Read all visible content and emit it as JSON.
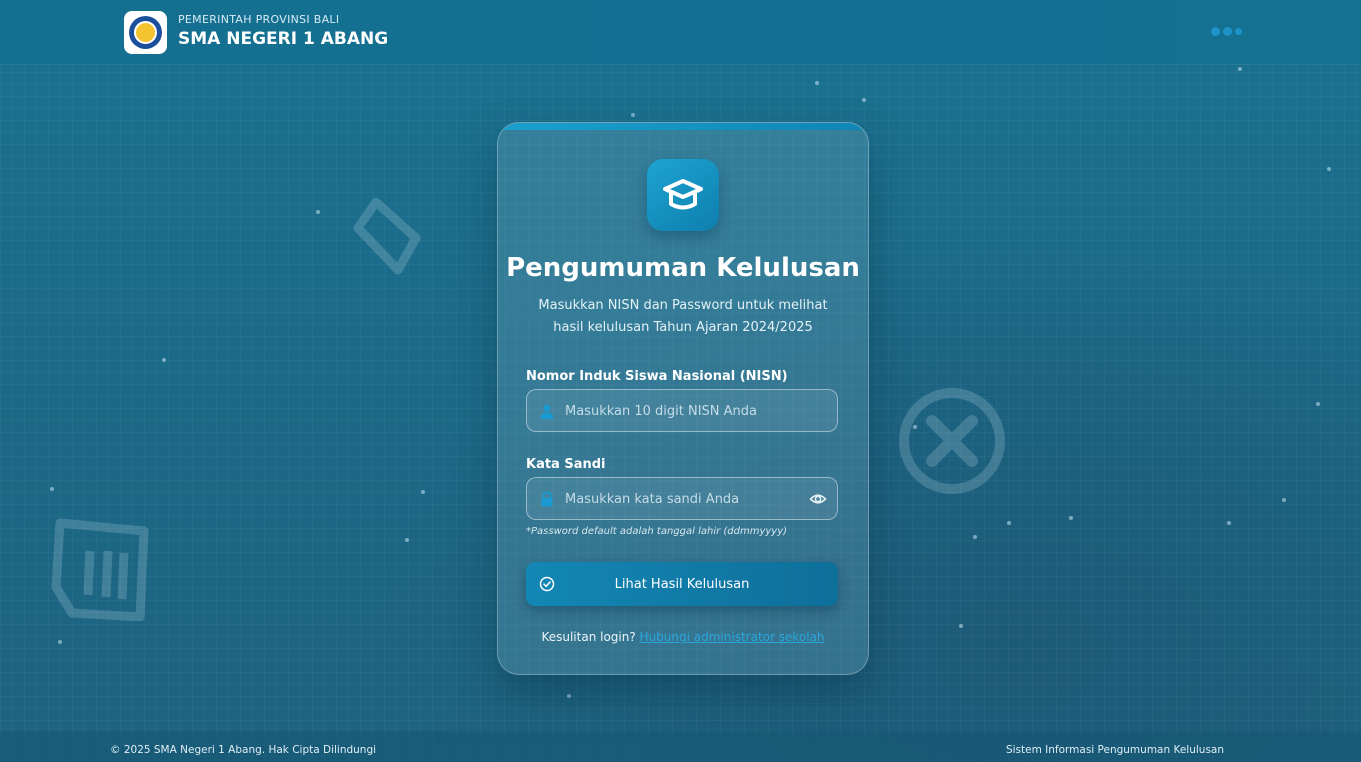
{
  "header": {
    "government": "PEMERINTAH PROVINSI BALI",
    "school_name": "SMA NEGERI 1 ABANG",
    "logo_icon": "school-crest-icon",
    "menu_icon": "more-dots-icon"
  },
  "card": {
    "app_icon": "graduation-cap-icon",
    "title": "Pengumuman Kelulusan",
    "subtitle_line1": "Masukkan NISN dan Password untuk melihat",
    "subtitle_line2": "hasil kelulusan Tahun Ajaran 2024/2025",
    "nisn": {
      "label": "Nomor Induk Siswa Nasional (NISN)",
      "placeholder": "Masukkan 10 digit NISN Anda",
      "value": "",
      "icon": "user-icon"
    },
    "password": {
      "label": "Kata Sandi",
      "placeholder": "Masukkan kata sandi Anda",
      "value": "",
      "icon": "lock-icon",
      "toggle_icon": "eye-icon"
    },
    "hint": "*Password default adalah tanggal lahir (ddmmyyyy)",
    "submit_label": "Lihat Hasil Kelulusan",
    "submit_icon": "check-circle-icon",
    "help_text": "Kesulitan login?",
    "help_link": "Hubungi administrator sekolah"
  },
  "footer": {
    "copyright": "© 2025 SMA Negeri 1 Abang. Hak Cipta Dilindungi",
    "system_name": "Sistem Informasi Pengumuman Kelulusan"
  },
  "colors": {
    "accent": "#1496c8",
    "background": "#1b6d8b",
    "link": "#2aa7dc"
  }
}
